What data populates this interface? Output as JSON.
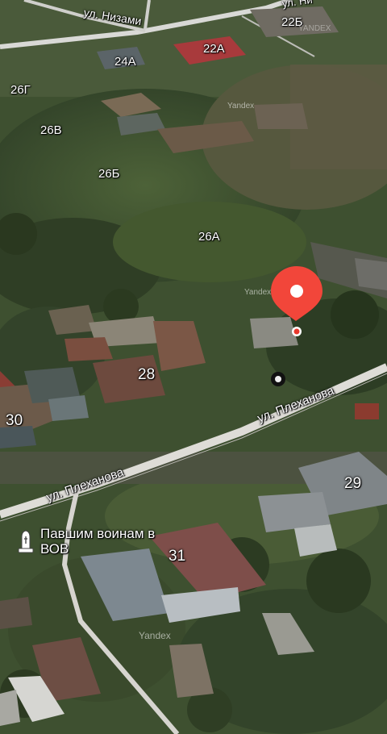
{
  "map": {
    "streets": {
      "nizami": "ул. Низами",
      "plekhanov_upper": "ул. Плеханова",
      "plekhanov_lower": "ул. Плеханова",
      "top_right_partial": "ул. Ни"
    },
    "house_numbers": {
      "h22b": "22Б",
      "h22a": "22А",
      "h24a": "24А",
      "h26g": "26Г",
      "h26v": "26В",
      "h26b": "26Б",
      "h26a": "26А",
      "h28": "28",
      "h30": "30",
      "h29": "29",
      "h31": "31"
    },
    "poi": {
      "name": "Павшим воинам в ВОВ",
      "icon": "monument-icon"
    },
    "watermarks": {
      "w1": "Yandex",
      "w2": "Yandex",
      "w3": "Yandex",
      "w4": "YANDEX"
    },
    "marker": {
      "icon": "location-pin-icon",
      "color": "#f2463a"
    }
  }
}
